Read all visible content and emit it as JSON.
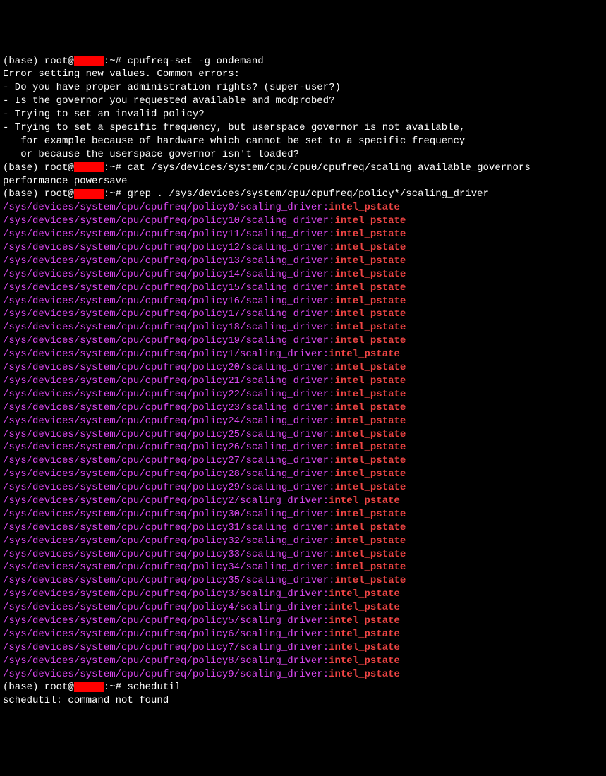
{
  "prompt": {
    "base": "(base) root@",
    "suffix": ":~# "
  },
  "cmd1": "cpufreq-set -g ondemand",
  "error_lines": [
    "Error setting new values. Common errors:",
    "- Do you have proper administration rights? (super-user?)",
    "- Is the governor you requested available and modprobed?",
    "- Trying to set an invalid policy?",
    "- Trying to set a specific frequency, but userspace governor is not available,",
    "   for example because of hardware which cannot be set to a specific frequency",
    "   or because the userspace governor isn't loaded?"
  ],
  "cmd2": "cat /sys/devices/system/cpu/cpu0/cpufreq/scaling_available_governors",
  "cmd2_output": "performance powersave",
  "cmd3": "grep . /sys/devices/system/cpu/cpufreq/policy*/scaling_driver",
  "grep_path_prefix": "/sys/devices/system/cpu/cpufreq/policy",
  "grep_path_suffix": "/scaling_driver",
  "grep_value": "intel_pstate",
  "grep_colon": ":",
  "policy_ids": [
    "0",
    "10",
    "11",
    "12",
    "13",
    "14",
    "15",
    "16",
    "17",
    "18",
    "19",
    "1",
    "20",
    "21",
    "22",
    "23",
    "24",
    "25",
    "26",
    "27",
    "28",
    "29",
    "2",
    "30",
    "31",
    "32",
    "33",
    "34",
    "35",
    "3",
    "4",
    "5",
    "6",
    "7",
    "8",
    "9"
  ],
  "cmd4": "schedutil",
  "cmd4_output": "schedutil: command not found"
}
